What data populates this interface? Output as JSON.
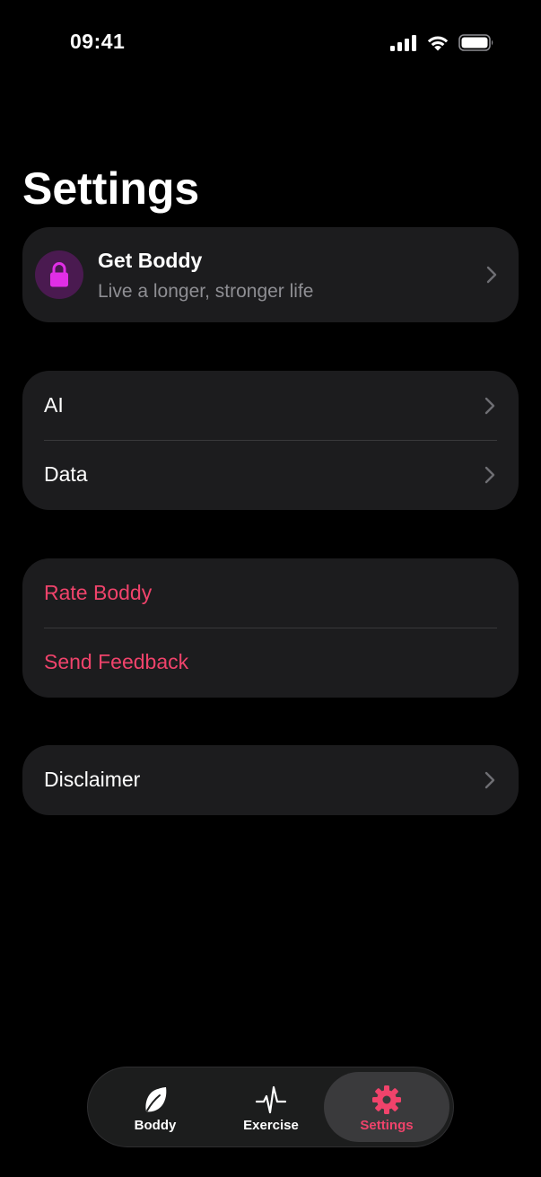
{
  "status_bar": {
    "time": "09:41"
  },
  "page": {
    "title": "Settings"
  },
  "premium": {
    "title": "Get Boddy",
    "subtitle": "Live a longer, stronger life",
    "icon": "lock-icon"
  },
  "settings_group": {
    "items": [
      {
        "label": "AI"
      },
      {
        "label": "Data"
      }
    ]
  },
  "feedback_group": {
    "items": [
      {
        "label": "Rate Boddy"
      },
      {
        "label": "Send Feedback"
      }
    ]
  },
  "disclaimer_group": {
    "items": [
      {
        "label": "Disclaimer"
      }
    ]
  },
  "tab_bar": {
    "tabs": [
      {
        "label": "Boddy",
        "icon": "leaf-icon"
      },
      {
        "label": "Exercise",
        "icon": "heartbeat-icon"
      },
      {
        "label": "Settings",
        "icon": "gear-icon",
        "selected": true
      }
    ]
  },
  "colors": {
    "background": "#000000",
    "card": "#1c1c1e",
    "accent": "#f0436b",
    "lock_accent": "#e12ee6",
    "secondary_text": "#8e8e93"
  }
}
